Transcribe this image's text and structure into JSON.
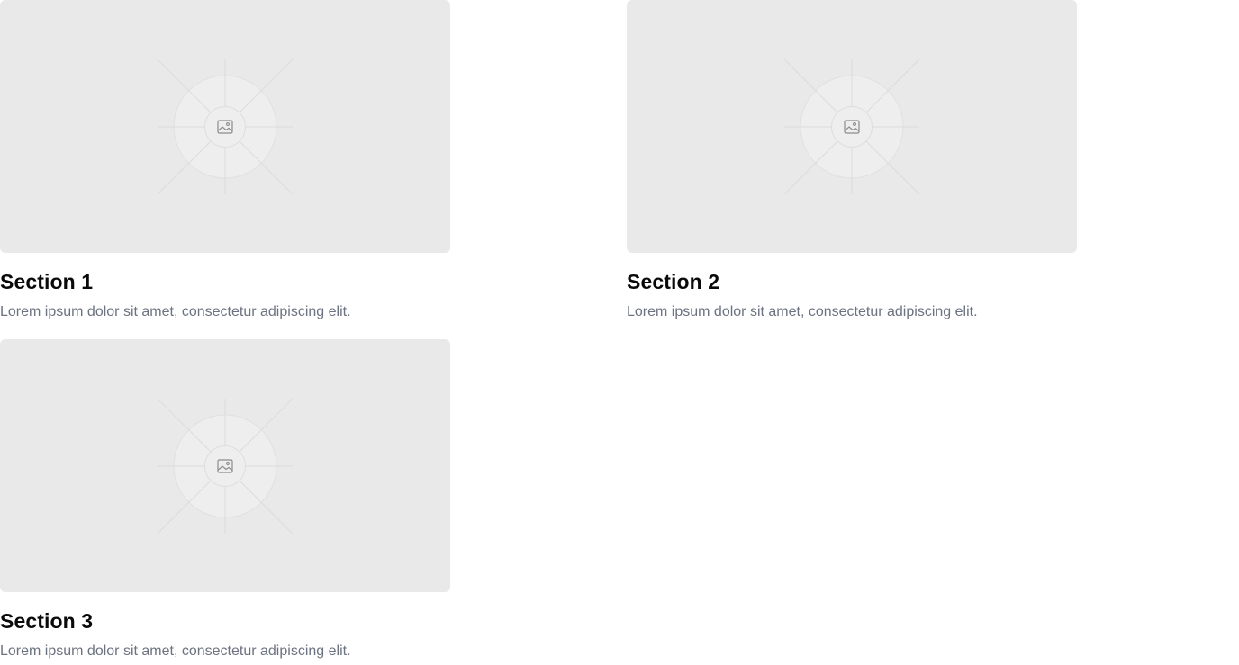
{
  "sections": [
    {
      "title": "Section 1",
      "description": "Lorem ipsum dolor sit amet, consectetur adipiscing elit.",
      "image_icon": "image-icon"
    },
    {
      "title": "Section 2",
      "description": "Lorem ipsum dolor sit amet, consectetur adipiscing elit.",
      "image_icon": "image-icon"
    },
    {
      "title": "Section 3",
      "description": "Lorem ipsum dolor sit amet, consectetur adipiscing elit.",
      "image_icon": "image-icon"
    }
  ],
  "colors": {
    "placeholder_bg": "#e9e9e9",
    "title": "#0a0a0a",
    "description": "#6b7280"
  }
}
